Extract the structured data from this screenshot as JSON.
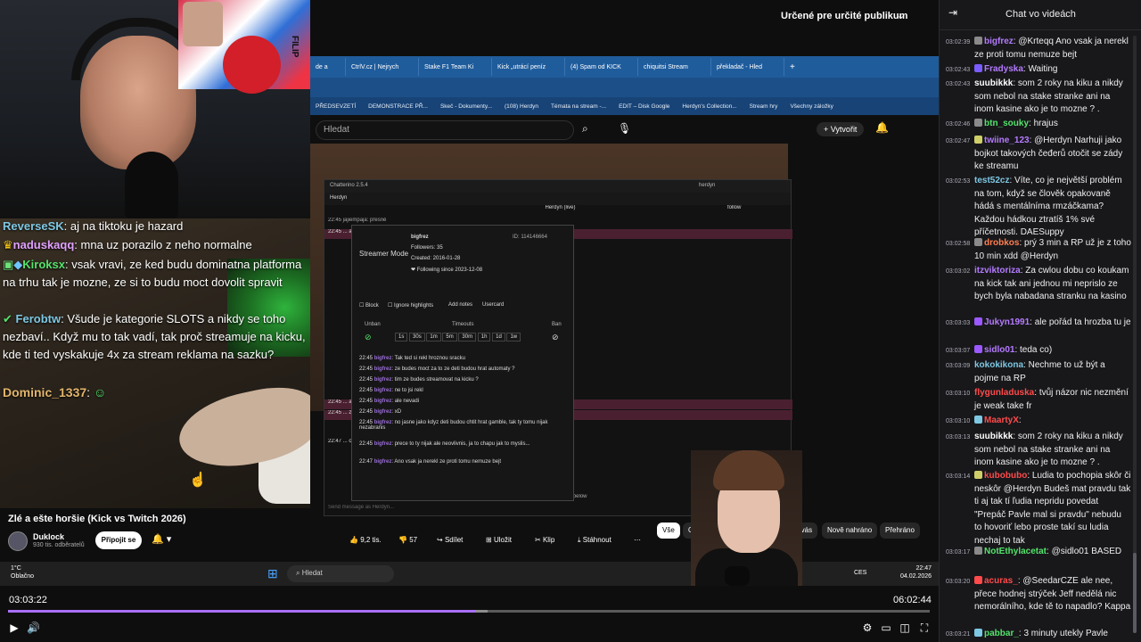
{
  "top_bar": {
    "audience_label": "Určené pre určité publikum"
  },
  "overlay_chat": [
    {
      "user": "ReverseSK",
      "text": "aj na tiktoku je hazard",
      "color": "#7ec8e3"
    },
    {
      "user": "naduskaqq",
      "text": "mna uz porazilo z neho normalne",
      "color": "#e0a0ff"
    },
    {
      "user": "Kiroksx",
      "text": "vsak vravi, ze ked budu dominatna platforma na trhu tak je mozne, ze si to budu moct dovolit spravit",
      "color": "#54e36b"
    },
    {
      "user": "Ferobtw",
      "text": "Všude je kategorie SLOTS a nikdy se toho nezbaví.. Když mu to tak vadí, tak proč streamuje na kicku, kde ti ted vyskakuje 4x za stream reklama na sazku?",
      "color": "#7ec8e3"
    },
    {
      "user": "Dominic_1337",
      "text": "",
      "color": "#e2b56b"
    }
  ],
  "poster_text": "FILIP",
  "browser": {
    "tabs": [
      "de a",
      "CtrlV.cz | Nejrych",
      "Stake F1 Team Ki",
      "Kick „utrácí peníz",
      "(4) Spam od KICK",
      "chiquitsi Stream",
      "překladač - Hled"
    ],
    "bookmarks": [
      "PŘEDSEVZETÍ",
      "DEMONSTRACE PŘ...",
      "Skeč - Dokumenty...",
      "(108) Herdyn",
      "Témata na stream -...",
      "EDIT – Disk Google",
      "Herdyn's Collection...",
      "Stream hry",
      "Všechny záložky"
    ],
    "yt_search_placeholder": "Hledat",
    "yt_create": "Vytvořit"
  },
  "chatterino": {
    "title": "Chatterino 2.5.4",
    "account": "herdyn",
    "tab": "Herdyn",
    "channel": "Herdyn (live)",
    "follow": "follow",
    "bg_lines": [
      "22:45  jajiempaja: přesně",
      "22:45  ... ale omieľal, tomu vlastne robíš reklamu.",
      "22:45  ... a že si za ním stojíš, ale dobře víš že tu bojuješ se zdí. Dobře víš, že tvůj názor nic",
      "22:45  ... zadu v ps změní názor voliče SPD či ANO.",
      "22:47  ... cyklus kde se to furt bude přelejvat ze strany na stranu a furt budou v plusu"
    ],
    "send_placeholder": "Send message as Herdyn...",
    "more_below": "more messages below",
    "popup": {
      "streamer_mode": "Streamer Mode",
      "user": "bigfrez",
      "id": "ID: 114146664",
      "followers": "Followers: 35",
      "created": "Created: 2016-01-28",
      "following": "❤ Following since 2023-12-08",
      "block": "Block",
      "ignore": "Ignore highlights",
      "add_notes": "Add notes",
      "usercard": "Usercard",
      "unban": "Unban",
      "timeouts": "Timeouts",
      "ban": "Ban",
      "timeout_opts": [
        "1s",
        "30s",
        "1m",
        "5m",
        "30m",
        "1h",
        "1d",
        "1w"
      ],
      "messages": [
        {
          "t": "22:45",
          "u": "bigfrez",
          "m": "Tak ted si rekl hroznou sracku"
        },
        {
          "t": "22:45",
          "u": "bigfrez",
          "m": "ze budes moct za to ze deti budou hrat automaty ?"
        },
        {
          "t": "22:45",
          "u": "bigfrez",
          "m": "tim ze budes streamovat na kicku ?"
        },
        {
          "t": "22:45",
          "u": "bigfrez",
          "m": "ne to jsi rekl"
        },
        {
          "t": "22:45",
          "u": "bigfrez",
          "m": "ale nevadi"
        },
        {
          "t": "22:45",
          "u": "bigfrez",
          "m": "xD"
        },
        {
          "t": "22:45",
          "u": "bigfrez",
          "m": "no jasne jako kdyz deti budou chtit hrat gamble, tak ty tomu nijak nezabranis"
        },
        {
          "t": "22:45",
          "u": "bigfrez",
          "m": "prece to ty nijak ale neovlivnis, ja to chapu jak to myslis..."
        },
        {
          "t": "22:47",
          "u": "bigfrez",
          "m": "Ano vsak ja nerekl ze proti tomu nemuze bejt"
        }
      ]
    }
  },
  "yt_meta": {
    "title": "Zlé a ešte horšie (Kick vs Twitch 2026)",
    "channel": "Duklock",
    "subs": "930 tis. odběratelů",
    "subscribe": "Připojit se",
    "likes": "9,2 tis.",
    "dislikes": "57",
    "share": "Sdílet",
    "save": "Uložit",
    "clip": "Klip",
    "download": "Stáhnout",
    "chips": [
      "Vše",
      "Od:",
      "Pro vás",
      "Nově nahráno",
      "Přehráno"
    ]
  },
  "taskbar": {
    "weather_temp": "1°C",
    "weather_desc": "Oblačno",
    "search": "Hledat",
    "lang": "CES",
    "time": "22:47",
    "date": "04.02.2026"
  },
  "player": {
    "current": "03:03:22",
    "total": "06:02:44",
    "progress": 0.507,
    "buffered": 0.52
  },
  "right_chat": {
    "header": "Chat vo videách",
    "messages": [
      {
        "ts": "03:02:39",
        "user": "bigfrez",
        "color": "#b57bff",
        "text": "@Krteqq Ano vsak ja nerekl ze proti tomu nemuze bejt",
        "badge": "#8a8a8a"
      },
      {
        "ts": "03:02:43",
        "user": "Fradyska",
        "color": "#b57bff",
        "text": "Waiting",
        "badge": "#7b5cff"
      },
      {
        "ts": "03:02:43",
        "user": "suubikkk",
        "color": "#ffffff",
        "text": "som 2 roky na kiku a nikdy som nebol na stake stranke ani na inom kasine ako je to mozne ? .",
        "badge": ""
      },
      {
        "ts": "03:02:46",
        "user": "btn_souky",
        "color": "#54e36b",
        "text": "hrajus",
        "badge": "#8a8a8a"
      },
      {
        "ts": "03:02:47",
        "user": "twiine_123",
        "color": "#b57bff",
        "text": "@Herdyn Narhuji jako bojkot takových čeđerů otočit se zády ke streamu",
        "badge": "#cfcf6a"
      },
      {
        "ts": "03:02:53",
        "user": "test52cz",
        "color": "#7ec8e3",
        "text": "Víte, co je největší problém na tom, když se člověk opakovaně hádá s mentálníma rmzáčkama? Každou hádkou ztratíš 1% své příčetnosti. DAESuppy",
        "badge": ""
      },
      {
        "ts": "03:02:58",
        "user": "drobkos",
        "color": "#ff7f50",
        "text": "prý 3 min a RP už je z toho 10 min xdd @Herdyn",
        "badge": "#8a8a8a"
      },
      {
        "ts": "03:03:02",
        "user": "itzviktoriza",
        "color": "#b57bff",
        "text": "Za cwlou dobu co koukam na kick tak ani jednou mi neprislo ze bych byla nabadana stranku na kasino",
        "badge": ""
      },
      {
        "ts": "03:03:03",
        "user": "Jukyn1991",
        "color": "#b57bff",
        "text": "ale pořád ta hrozba tu je",
        "badge": "#9b59ff"
      },
      {
        "ts": "03:03:07",
        "user": "sidlo01",
        "color": "#b57bff",
        "text": "teda co)",
        "badge": "#9b59ff"
      },
      {
        "ts": "03:03:09",
        "user": "kokokikona",
        "color": "#7ec8e3",
        "text": "Nechme to už být a pojme na RP",
        "badge": ""
      },
      {
        "ts": "03:03:10",
        "user": "flygunladuska",
        "color": "#ff4b4b",
        "text": "tvůj názor nic nezmění je weak take fr",
        "badge": ""
      },
      {
        "ts": "03:03:10",
        "user": "MaartyX",
        "color": "#ff4b4b",
        "text": "",
        "badge": "#7ec8e3"
      },
      {
        "ts": "03:03:13",
        "user": "suubikkk",
        "color": "#ffffff",
        "text": "som 2 roky na kiku a nikdy som nebol na stake stranke ani na inom kasine ako je to mozne ? .",
        "badge": ""
      },
      {
        "ts": "03:03:14",
        "user": "kubobubo",
        "color": "#ff4b4b",
        "text": "Ludia to pochopia skôr či neskôr @Herdyn Budeš mat pravdu tak ti aj tak tí ľudia nepridu povedat \"Prepáč Pavle mal si pravdu\" nebudu to hovoriť lebo proste takí su ludia nechaj to tak",
        "badge": "#cfcf6a"
      },
      {
        "ts": "03:03:17",
        "user": "NotEthylacetat",
        "color": "#54e36b",
        "text": "@sidlo01 BASED",
        "badge": "#8a8a8a"
      },
      {
        "ts": "03:03:20",
        "user": "acuras_",
        "color": "#ff4b4b",
        "text": "@SeedarCZE ale nee, přece hodnej strýček Jeff nedělá nic nemorálního, kde tě to napadlo? Kappa",
        "badge": "#ff4b4b"
      },
      {
        "ts": "03:03:21",
        "user": "pabbar_",
        "color": "#54e36b",
        "text": "3 minuty utekly Pavle",
        "badge": "#7ec8e3"
      }
    ]
  }
}
